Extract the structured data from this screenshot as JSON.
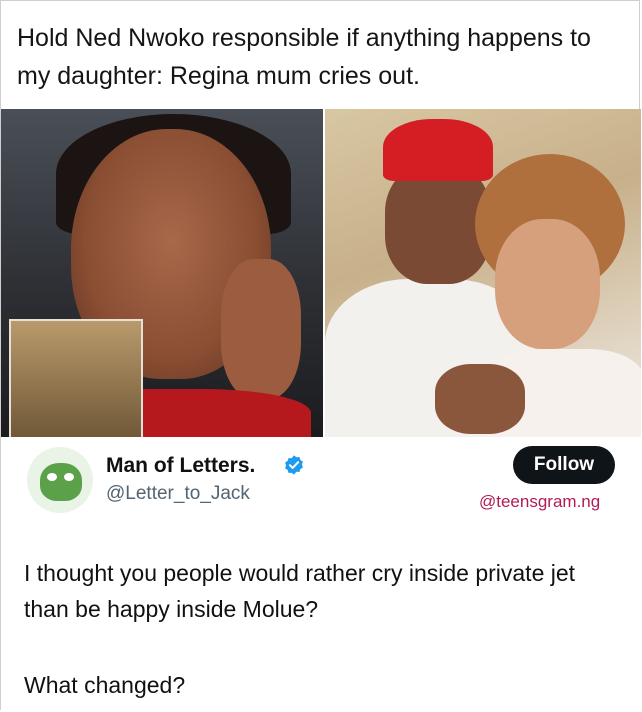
{
  "post": {
    "headline": "Hold Ned Nwoko responsible if anything happens to my daughter: Regina mum cries out."
  },
  "images": {
    "left_photo": "crying-woman-photo",
    "right_photo": "couple-photo"
  },
  "tweet": {
    "display_name": "Man of Letters.",
    "handle": "@Letter_to_Jack",
    "follow_label": "Follow",
    "watermark": "@teensgram.ng",
    "body_line1": "I thought you people would rather cry inside private jet than be happy inside Molue?",
    "body_line2": "What changed?",
    "verified_icon": "verified-badge-icon",
    "avatar_icon": "frog-avatar"
  },
  "colors": {
    "follow_bg": "#0f1419",
    "verified": "#1d9bf0",
    "watermark": "#b01c55",
    "handle": "#536471"
  }
}
